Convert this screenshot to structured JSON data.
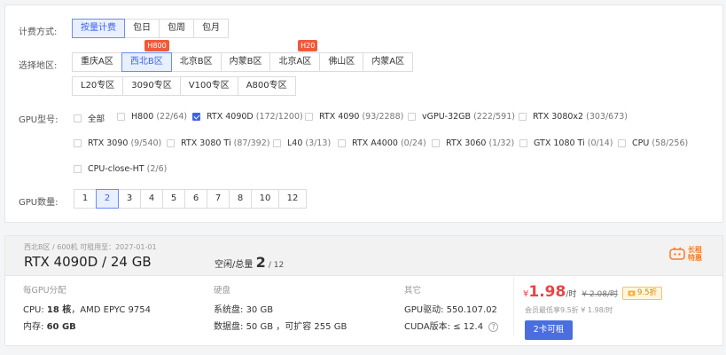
{
  "billing": {
    "label": "计费方式:",
    "options": [
      "按量计费",
      "包日",
      "包周",
      "包月"
    ],
    "selected_index": 0
  },
  "region": {
    "label": "选择地区:",
    "row1": [
      "重庆A区",
      "西北B区",
      "北京B区",
      "内蒙B区",
      "北京A区",
      "佛山区",
      "内蒙A区"
    ],
    "row2": [
      "L20专区",
      "3090专区",
      "V100专区",
      "A800专区"
    ],
    "selected": "西北B区",
    "badges": {
      "xibei_b": "H800",
      "beijing_a": "H20"
    }
  },
  "gpu_model": {
    "label": "GPU型号:",
    "items": [
      {
        "name": "全部",
        "count": ""
      },
      {
        "name": "H800",
        "count": "(22/64)"
      },
      {
        "name": "RTX 4090D",
        "count": "(172/1200)"
      },
      {
        "name": "RTX 4090",
        "count": "(93/2288)"
      },
      {
        "name": "vGPU-32GB",
        "count": "(222/591)"
      },
      {
        "name": "RTX 3080x2",
        "count": "(303/673)"
      },
      {
        "name": "RTX 3090",
        "count": "(9/540)"
      },
      {
        "name": "RTX 3080 Ti",
        "count": "(87/392)"
      },
      {
        "name": "L40",
        "count": "(3/13)"
      },
      {
        "name": "RTX A4000",
        "count": "(0/24)"
      },
      {
        "name": "RTX 3060",
        "count": "(1/32)"
      },
      {
        "name": "GTX 1080 Ti",
        "count": "(0/14)"
      },
      {
        "name": "CPU",
        "count": "(58/256)"
      },
      {
        "name": "CPU-close-HT",
        "count": "(2/6)"
      }
    ],
    "checked": "RTX 4090D"
  },
  "gpu_count": {
    "label": "GPU数量:",
    "options": [
      "1",
      "2",
      "3",
      "4",
      "5",
      "6",
      "7",
      "8",
      "10",
      "12"
    ],
    "selected": "2"
  },
  "card": {
    "meta": "西北B区 / 600机   可租用至：2027-01-01",
    "title": "RTX 4090D / 24 GB",
    "avail_label": "空闲/总量",
    "avail_free": "2",
    "avail_total": "/ 12",
    "promo": "长租特惠",
    "sections": {
      "per_gpu": {
        "header": "每GPU分配",
        "cpu_label": "CPU:",
        "cpu_cores": "18 核",
        "cpu_model": "，AMD EPYC 9754",
        "mem_label": "内存:",
        "mem_value": "60 GB"
      },
      "disk": {
        "header": "硬盘",
        "sys_label": "系统盘:",
        "sys_value": "30 GB",
        "data_label": "数据盘:",
        "data_value": "50 GB ，可扩容 255 GB"
      },
      "other": {
        "header": "其它",
        "driver_label": "GPU驱动:",
        "driver_value": "550.107.02",
        "cuda_label": "CUDA版本:",
        "cuda_value": "≤ 12.4"
      }
    },
    "price": {
      "currency": "¥",
      "amount": "1.98",
      "unit": "/时",
      "old": "¥ 2.08/时",
      "discount": "9.5折",
      "member_line": "会员最低享9.5折  ¥ 1.98/时",
      "button": "2卡可租"
    }
  },
  "colors": {
    "accent": "#3f63e6",
    "accent_bg": "#e8efff",
    "price_red": "#e84545",
    "badge_red": "#f05a3a",
    "promo_orange": "#ff7a1a",
    "button_blue": "#4a6ee0"
  }
}
